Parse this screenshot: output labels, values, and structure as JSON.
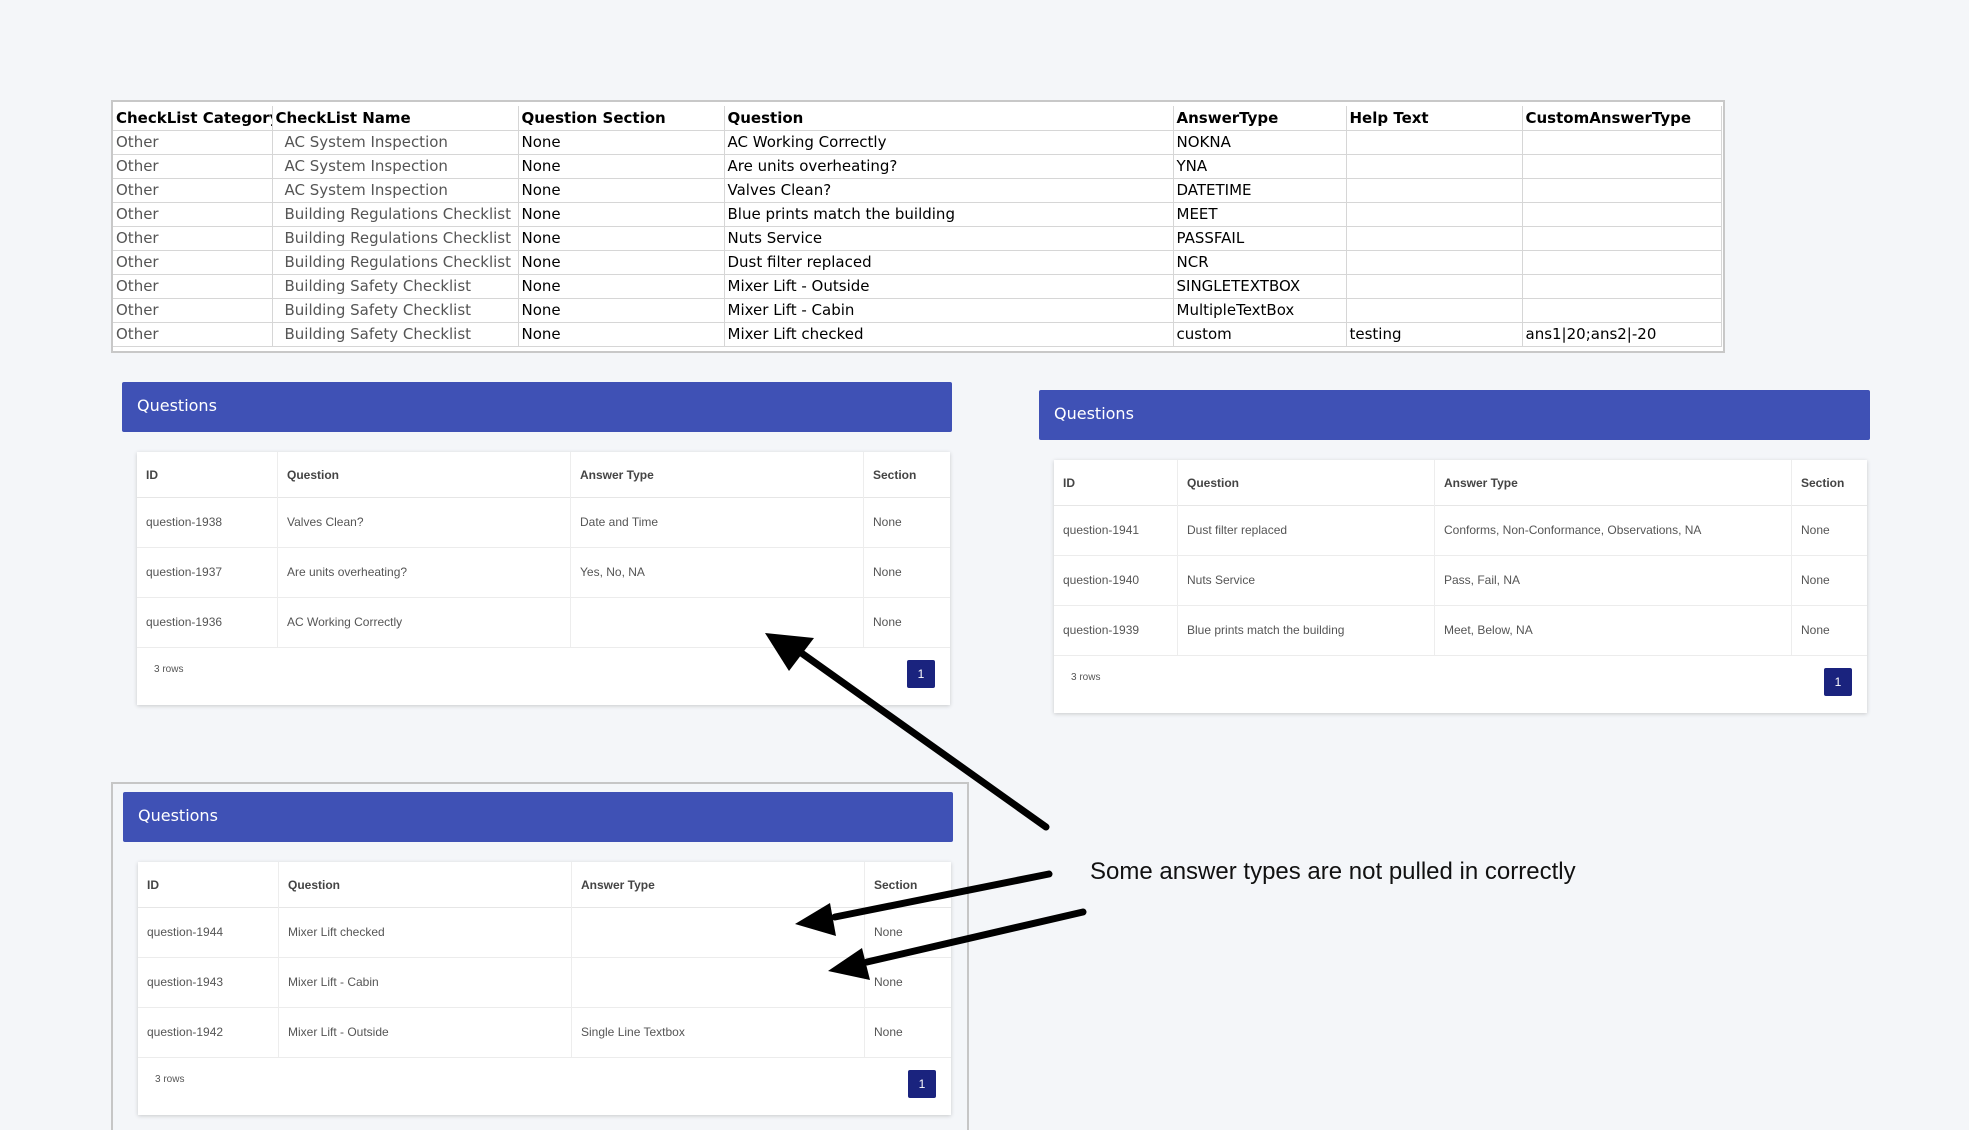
{
  "spreadsheet": {
    "headers": [
      "CheckList Category",
      "CheckList Name",
      "Question Section",
      "Question",
      "AnswerType",
      "Help Text",
      "CustomAnswerType"
    ],
    "rows": [
      [
        "Other",
        "AC System Inspection",
        "None",
        "AC Working Correctly",
        "NOKNA",
        "",
        ""
      ],
      [
        "Other",
        "AC System Inspection",
        "None",
        "Are units overheating?",
        "YNA",
        "",
        ""
      ],
      [
        "Other",
        "AC System Inspection",
        "None",
        "Valves Clean?",
        "DATETIME",
        "",
        ""
      ],
      [
        "Other",
        "Building Regulations Checklist",
        "None",
        "Blue prints match the building",
        "MEET",
        "",
        ""
      ],
      [
        "Other",
        "Building Regulations Checklist",
        "None",
        "Nuts Service",
        "PASSFAIL",
        "",
        ""
      ],
      [
        "Other",
        "Building Regulations Checklist",
        "None",
        "Dust filter replaced",
        "NCR",
        "",
        ""
      ],
      [
        "Other",
        "Building Safety Checklist",
        "None",
        "Mixer Lift - Outside",
        "SINGLETEXTBOX",
        "",
        ""
      ],
      [
        "Other",
        "Building Safety Checklist",
        "None",
        "Mixer Lift - Cabin",
        "MultipleTextBox",
        "",
        ""
      ],
      [
        "Other",
        "Building Safety Checklist",
        "None",
        "Mixer Lift  checked",
        "custom",
        "testing",
        "ans1|20;ans2|-20"
      ]
    ]
  },
  "panels": [
    {
      "title": "Questions",
      "columns": [
        "ID",
        "Question",
        "Answer Type",
        "Section"
      ],
      "rows": [
        [
          "question-1938",
          "Valves Clean?",
          "Date and Time",
          "None"
        ],
        [
          "question-1937",
          "Are units overheating?",
          "Yes, No, NA",
          "None"
        ],
        [
          "question-1936",
          "AC Working Correctly",
          "",
          "None"
        ]
      ],
      "row_count": "3 rows",
      "page": "1"
    },
    {
      "title": "Questions",
      "columns": [
        "ID",
        "Question",
        "Answer Type",
        "Section"
      ],
      "rows": [
        [
          "question-1941",
          "Dust filter replaced",
          "Conforms, Non-Conformance, Observations, NA",
          "None"
        ],
        [
          "question-1940",
          "Nuts Service",
          "Pass, Fail, NA",
          "None"
        ],
        [
          "question-1939",
          "Blue prints match the building",
          "Meet, Below, NA",
          "None"
        ]
      ],
      "row_count": "3 rows",
      "page": "1"
    },
    {
      "title": "Questions",
      "columns": [
        "ID",
        "Question",
        "Answer Type",
        "Section"
      ],
      "rows": [
        [
          "question-1944",
          "Mixer Lift checked",
          "",
          "None"
        ],
        [
          "question-1943",
          "Mixer Lift - Cabin",
          "",
          "None"
        ],
        [
          "question-1942",
          "Mixer Lift - Outside",
          "Single Line Textbox",
          "None"
        ]
      ],
      "row_count": "3 rows",
      "page": "1"
    }
  ],
  "annotation": "Some answer types are not pulled in correctly",
  "colors": {
    "header": "#3f51b5",
    "page_button": "#1a237e",
    "background": "#f4f6f9",
    "arrow": "#000000"
  }
}
